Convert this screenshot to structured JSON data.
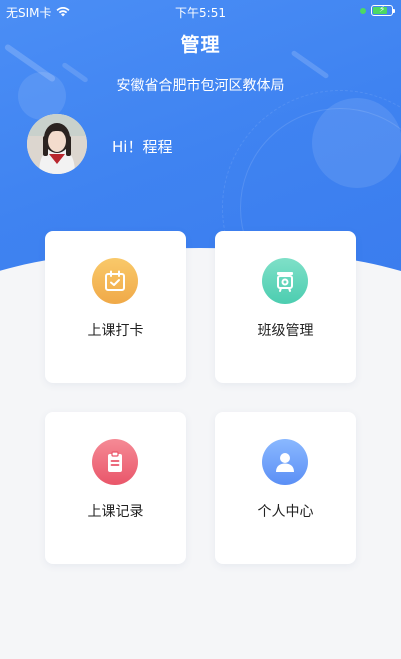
{
  "status_bar": {
    "carrier": "无SIM卡",
    "time": "下午5:51"
  },
  "header": {
    "title": "管理",
    "organization": "安徽省合肥市包河区教体局"
  },
  "profile": {
    "greeting": "Hi！程程"
  },
  "menu": [
    {
      "label": "上课打卡",
      "icon": "calendar-check-icon",
      "color": "#f0a948"
    },
    {
      "label": "班级管理",
      "icon": "class-board-icon",
      "color": "#4ccdb0"
    },
    {
      "label": "上课记录",
      "icon": "clipboard-icon",
      "color": "#e9566a"
    },
    {
      "label": "个人中心",
      "icon": "user-icon",
      "color": "#5b8ff5"
    }
  ],
  "colors": {
    "primary": "#3f83f1",
    "background": "#f5f6f8"
  }
}
